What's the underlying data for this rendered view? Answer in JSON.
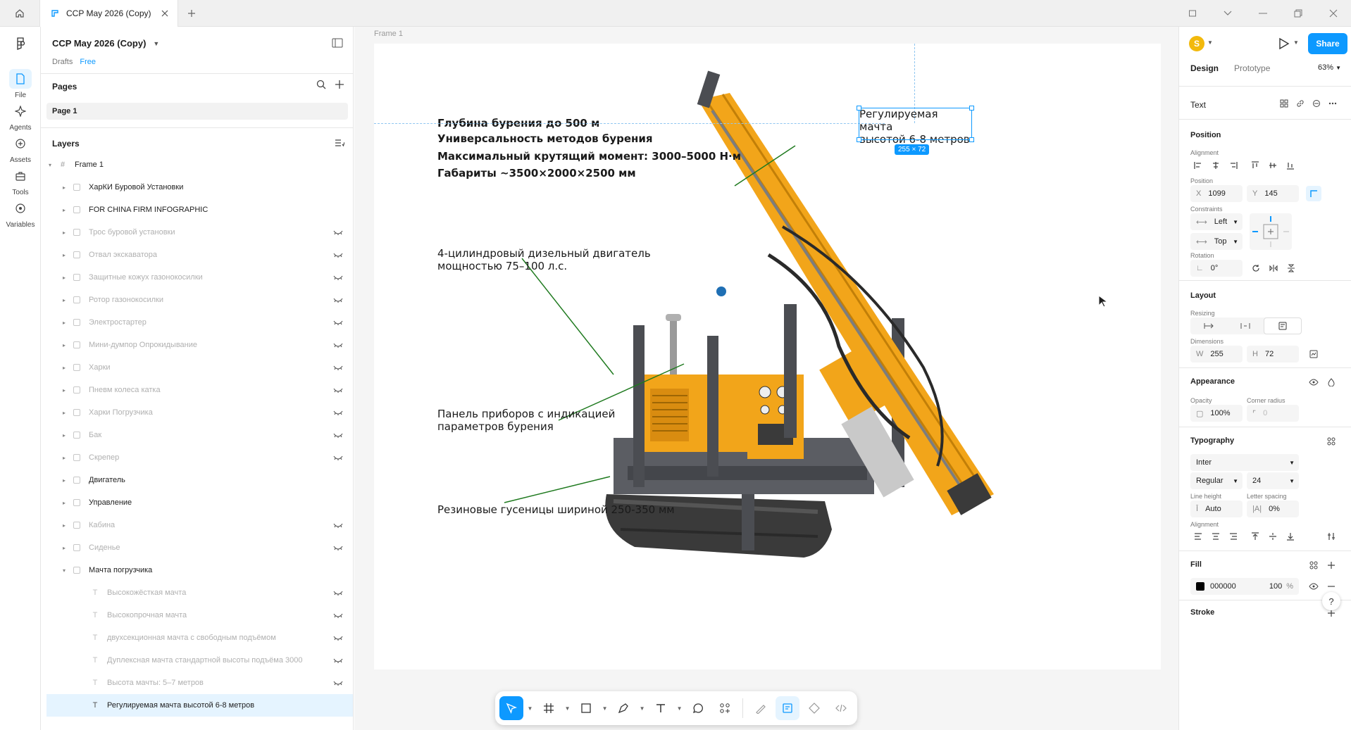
{
  "titlebar": {
    "tab_title": "CCP May 2026 (Copy)"
  },
  "rail": {
    "items": [
      {
        "label": "File",
        "icon": "file-icon"
      },
      {
        "label": "Agents",
        "icon": "agents-icon"
      },
      {
        "label": "Assets",
        "icon": "assets-icon"
      },
      {
        "label": "Tools",
        "icon": "tools-icon"
      },
      {
        "label": "Variables",
        "icon": "variables-icon"
      }
    ]
  },
  "left_panel": {
    "file_name": "CCP May 2026 (Copy)",
    "drafts": "Drafts",
    "plan": "Free",
    "pages_title": "Pages",
    "page_name": "Page 1",
    "layers_title": "Layers",
    "layers": [
      {
        "name": "Frame 1",
        "type": "frame",
        "hidden": false,
        "expanded": true
      },
      {
        "name": "ХарКИ Буровой Установки",
        "type": "group",
        "hidden": false
      },
      {
        "name": "FOR CHINA FIRM INFOGRAPHIC",
        "type": "group",
        "hidden": false
      },
      {
        "name": "Трос буровой установки",
        "type": "group",
        "hidden": true
      },
      {
        "name": "Отвал экскаватора",
        "type": "group",
        "hidden": true
      },
      {
        "name": "Защитные кожух газонокосилки",
        "type": "group",
        "hidden": true
      },
      {
        "name": "Ротор газонокосилки",
        "type": "group",
        "hidden": true
      },
      {
        "name": "Электростартер",
        "type": "group",
        "hidden": true
      },
      {
        "name": "Мини-думпор Опрокидывание",
        "type": "group",
        "hidden": true
      },
      {
        "name": "Харки",
        "type": "group",
        "hidden": true
      },
      {
        "name": "Пневм колеса катка",
        "type": "group",
        "hidden": true
      },
      {
        "name": "Харки Погрузчика",
        "type": "group",
        "hidden": true
      },
      {
        "name": "Бак",
        "type": "group",
        "hidden": true
      },
      {
        "name": "Скрепер",
        "type": "group",
        "hidden": true
      },
      {
        "name": "Двигатель",
        "type": "group",
        "hidden": false
      },
      {
        "name": "Управление",
        "type": "group",
        "hidden": false
      },
      {
        "name": "Кабина",
        "type": "group",
        "hidden": true
      },
      {
        "name": "Сиденье",
        "type": "group",
        "hidden": true
      },
      {
        "name": "Мачта погрузчика",
        "type": "group",
        "hidden": false,
        "expanded": true
      },
      {
        "name": "Высокожёсткая мачта",
        "type": "text",
        "hidden": true
      },
      {
        "name": "Высокопрочная мачта",
        "type": "text",
        "hidden": true
      },
      {
        "name": "двухсекционная мачта с свободным подъёмом",
        "type": "text",
        "hidden": true
      },
      {
        "name": "Дуплексная мачта стандартной высоты подъёма 3000",
        "type": "text",
        "hidden": true
      },
      {
        "name": "Высота мачты: 5–7 метров",
        "type": "text",
        "hidden": true
      },
      {
        "name": "Регулируемая мачта высотой 6-8 метров",
        "type": "text",
        "hidden": false,
        "selected": true
      }
    ]
  },
  "canvas": {
    "frame_label": "Frame 1",
    "specs": [
      "Глубина бурения до 500 м",
      "Универсальность методов бурения",
      "Максимальный крутящий момент: 3000–5000 Н·м",
      "Габариты ~3500×2000×2500 мм"
    ],
    "callouts": {
      "engine_line1": "4-цилиндровый дизельный двигатель",
      "engine_line2": "мощностью 75–100 л.с.",
      "panel_line1": "Панель приборов с индикацией",
      "panel_line2": "параметров бурения",
      "tracks": "Резиновые гусеницы шириной 250-350 мм",
      "mast_line1": "Регулируемая мачта",
      "mast_line2": "высотой 6-8 метров"
    },
    "selection_size": "255 × 72",
    "leader_color": "#1f7a1f",
    "machine_color": "#f2a51a"
  },
  "right_panel": {
    "avatar_initial": "S",
    "share": "Share",
    "tab_design": "Design",
    "tab_prototype": "Prototype",
    "zoom": "63%",
    "layer_type": "Text",
    "position_title": "Position",
    "alignment_label": "Alignment",
    "position_label": "Position",
    "x_label": "X",
    "x_value": "1099",
    "y_label": "Y",
    "y_value": "145",
    "constraints_label": "Constraints",
    "constraint_h": "Left",
    "constraint_v": "Top",
    "rotation_label": "Rotation",
    "rotation_value": "0°",
    "layout_title": "Layout",
    "resizing_label": "Resizing",
    "dimensions_label": "Dimensions",
    "w_label": "W",
    "w_value": "255",
    "h_label": "H",
    "h_value": "72",
    "appearance_title": "Appearance",
    "opacity_label": "Opacity",
    "opacity_value": "100%",
    "corner_label": "Corner radius",
    "corner_value": "0",
    "typography_title": "Typography",
    "font_family": "Inter",
    "font_weight": "Regular",
    "font_size": "24",
    "line_height_label": "Line height",
    "line_height_value": "Auto",
    "letter_spacing_label": "Letter spacing",
    "letter_spacing_value": "0%",
    "alignment_label2": "Alignment",
    "fill_title": "Fill",
    "fill_hex": "000000",
    "fill_opacity": "100",
    "fill_pct": "%",
    "stroke_title": "Stroke",
    "help": "?"
  },
  "accent_color": "#0d99ff"
}
